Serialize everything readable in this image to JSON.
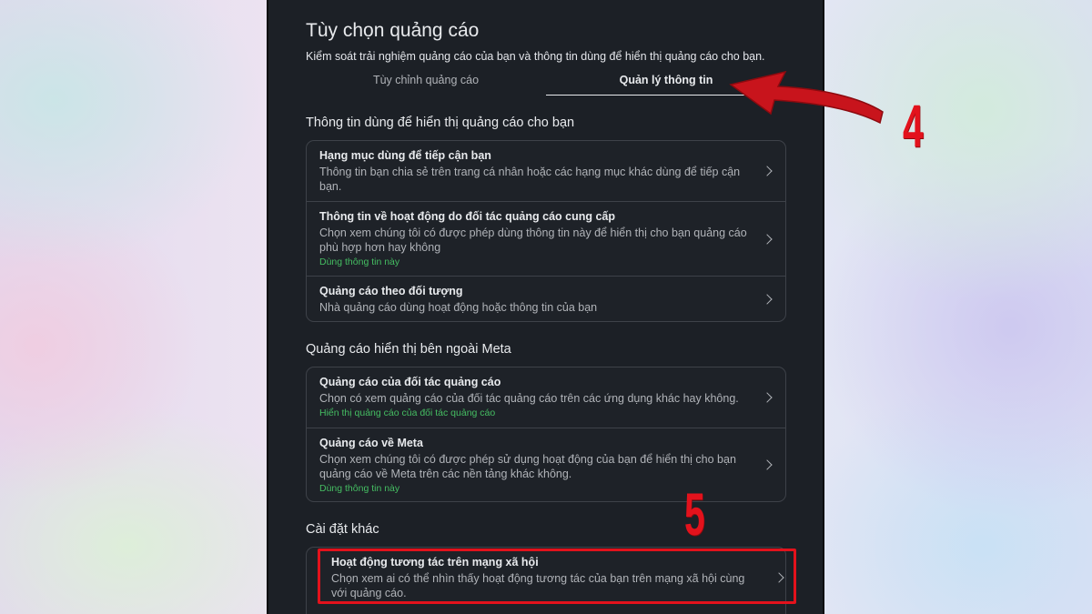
{
  "header": {
    "title": "Tùy chọn quảng cáo",
    "subtitle": "Kiểm soát trải nghiệm quảng cáo của bạn và thông tin dùng để hiển thị quảng cáo cho bạn."
  },
  "tabs": [
    {
      "label": "Tùy chỉnh quảng cáo",
      "active": false
    },
    {
      "label": "Quản lý thông tin",
      "active": true
    }
  ],
  "sections": [
    {
      "title": "Thông tin dùng để hiển thị quảng cáo cho bạn",
      "rows": [
        {
          "title": "Hạng mục dùng để tiếp cận bạn",
          "desc": "Thông tin bạn chia sẻ trên trang cá nhân hoặc các hạng mục khác dùng để tiếp cận bạn.",
          "status": ""
        },
        {
          "title": "Thông tin về hoạt động do đối tác quảng cáo cung cấp",
          "desc": "Chọn xem chúng tôi có được phép dùng thông tin này để hiển thị cho bạn quảng cáo phù hợp hơn hay không",
          "status": "Dùng thông tin này"
        },
        {
          "title": "Quảng cáo theo đối tượng",
          "desc": "Nhà quảng cáo dùng hoạt động hoặc thông tin của bạn",
          "status": ""
        }
      ]
    },
    {
      "title": "Quảng cáo hiển thị bên ngoài Meta",
      "rows": [
        {
          "title": "Quảng cáo của đối tác quảng cáo",
          "desc": "Chọn có xem quảng cáo của đối tác quảng cáo trên các ứng dụng khác hay không.",
          "status": "Hiển thị quảng cáo của đối tác quảng cáo"
        },
        {
          "title": "Quảng cáo về Meta",
          "desc": "Chọn xem chúng tôi có được phép sử dụng hoạt động của bạn để hiển thị cho bạn quảng cáo về Meta trên các nền tảng khác không.",
          "status": "Dùng thông tin này"
        }
      ]
    },
    {
      "title": "Cài đặt khác",
      "rows": [
        {
          "title": "Hoạt động tương tác trên mạng xã hội",
          "desc": "Chọn xem ai có thể nhìn thấy hoạt động tương tác của bạn trên mạng xã hội cùng với quảng cáo.",
          "status": ""
        }
      ]
    }
  ],
  "annotations": {
    "step_4": "4",
    "step_5": "5"
  },
  "colors": {
    "panel_bg": "#1c2026",
    "status_green": "#45bd62",
    "annotation_red": "#e3121c"
  },
  "icons": {
    "row_chevron": "chevron-right-icon",
    "pointer": "red-arrow-icon"
  }
}
